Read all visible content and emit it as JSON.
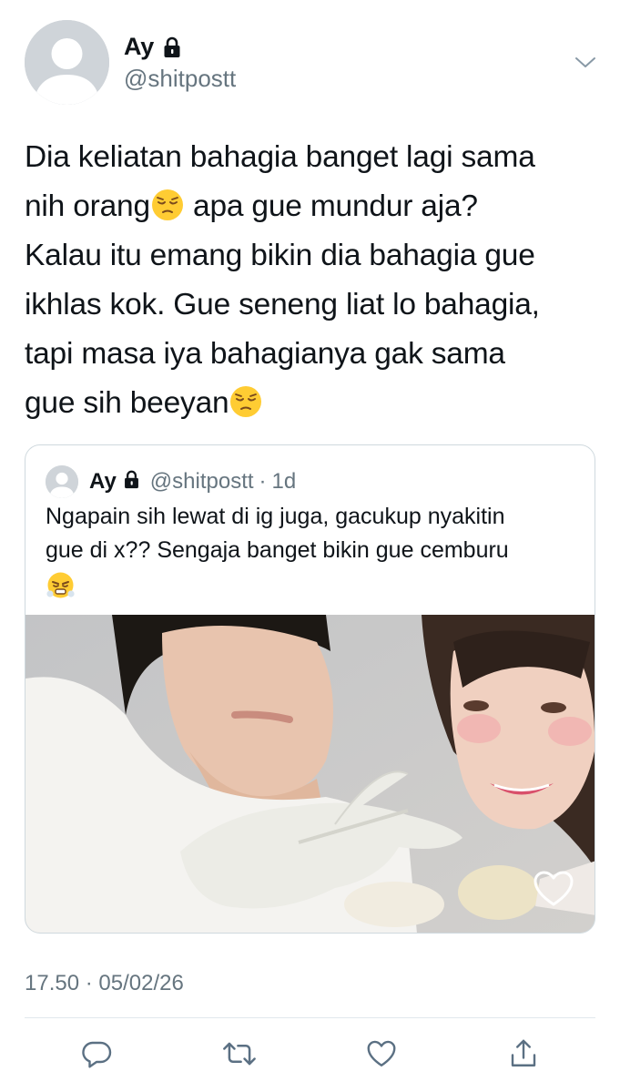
{
  "tweet": {
    "author": {
      "display_name": "Ay",
      "handle": "@shitpostt",
      "avatar_icon": "default-avatar-icon",
      "protected_icon": "lock-icon"
    },
    "menu_icon": "chevron-down-icon",
    "text_lines": [
      [
        "Dia keliatan bahagia banget lagi sama"
      ],
      [
        "nih orang",
        "😔",
        " apa gue mundur aja?"
      ],
      [
        "Kalau itu emang bikin dia bahagia gue"
      ],
      [
        "ikhlas kok. Gue seneng liat lo bahagia,"
      ],
      [
        "tapi masa iya bahagianya gak sama"
      ],
      [
        "gue sih beeyan",
        "😔"
      ]
    ],
    "line1": "Dia keliatan bahagia banget lagi sama",
    "line2_a": "nih orang",
    "line2_emoji": "pensive-face-emoji",
    "line2_b": " apa gue mundur aja?",
    "line3": "Kalau itu emang bikin dia bahagia gue",
    "line4": "ikhlas kok. Gue seneng liat lo bahagia,",
    "line5": "tapi masa iya bahagianya gak sama",
    "line6_a": "gue sih beeyan",
    "line6_emoji": "pensive-face-emoji"
  },
  "quoted": {
    "display_name": "Ay",
    "handle": "@shitpostt",
    "separator": "·",
    "relative_time": "1d",
    "line1": "Ngapain sih lewat di ig juga, gacukup nyakitin",
    "line2": "gue di x?? Sengaja banget bikin gue cemburu",
    "emoji": "face-with-steam-from-nose-emoji",
    "media": {
      "description_icon": "photo-media",
      "like_icon": "heart-outline-icon"
    }
  },
  "meta": {
    "timestamp": "17.50 · 05/02/26"
  },
  "actions": {
    "reply_icon": "reply-icon",
    "retweet_icon": "retweet-icon",
    "like_icon": "heart-icon",
    "share_icon": "share-icon"
  },
  "colors": {
    "text": "#0f1419",
    "secondary": "#66757f",
    "border": "#cfd9de",
    "avatar_bg": "#cfd4d9",
    "avatar_fg": "#ffffff"
  }
}
